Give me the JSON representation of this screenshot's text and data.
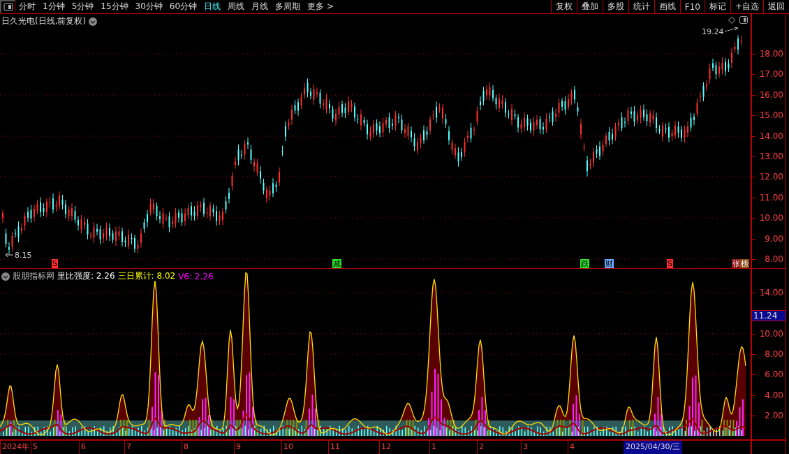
{
  "toolbar": {
    "periods": [
      {
        "label": "分时",
        "selected": false
      },
      {
        "label": "1分钟",
        "selected": false
      },
      {
        "label": "5分钟",
        "selected": false
      },
      {
        "label": "15分钟",
        "selected": false
      },
      {
        "label": "30分钟",
        "selected": false
      },
      {
        "label": "60分钟",
        "selected": false
      },
      {
        "label": "日线",
        "selected": true
      },
      {
        "label": "周线",
        "selected": false
      },
      {
        "label": "月线",
        "selected": false
      },
      {
        "label": "多周期",
        "selected": false
      },
      {
        "label": "更多 >",
        "selected": false
      }
    ],
    "buttons": [
      "复权",
      "叠加",
      "多股",
      "统计",
      "画线",
      "F10",
      "标记",
      "+自选",
      "返回"
    ]
  },
  "price_chart": {
    "title": "日久光电(日线,前复权)",
    "high_label": "19.24",
    "low_label": "8.15",
    "yticks": [
      "18.00",
      "17.00",
      "16.00",
      "15.00",
      "14.00",
      "13.00",
      "12.00",
      "11.00",
      "10.00",
      "9.00",
      "8.00"
    ],
    "events": [
      {
        "label": "S",
        "kind": "mark",
        "color": "#ff3030"
      },
      {
        "label": "减",
        "kind": "mark",
        "color": "#30e030"
      },
      {
        "label": "跌",
        "kind": "mark",
        "color": "#30e030"
      },
      {
        "label": "财",
        "kind": "mark",
        "color": "#6aa8ff"
      },
      {
        "label": "S",
        "kind": "mark",
        "color": "#ff3030"
      },
      {
        "label": "张",
        "kind": "badge",
        "color": "#8b1010"
      },
      {
        "label": "榜",
        "kind": "badge",
        "color": "#8a4a10"
      }
    ]
  },
  "indicator": {
    "name": "股朋指标网",
    "readouts": [
      {
        "label": "里比强度: 2.26",
        "color": "#ffffff"
      },
      {
        "label": "三日累计: 8.02",
        "color": "#ffff00"
      },
      {
        "label": "V6: 2.26",
        "color": "#ff00ff"
      }
    ],
    "yticks": [
      "14.00",
      "10.00",
      "8.00",
      "6.00",
      "4.00",
      "2.00"
    ],
    "current_value": "11.24"
  },
  "date_axis": {
    "labels": [
      "2024年",
      "5",
      "6",
      "7",
      "8",
      "9",
      "10",
      "11",
      "12",
      "1",
      "2",
      "3",
      "4"
    ],
    "current_date": "2025/04/30/三"
  }
}
